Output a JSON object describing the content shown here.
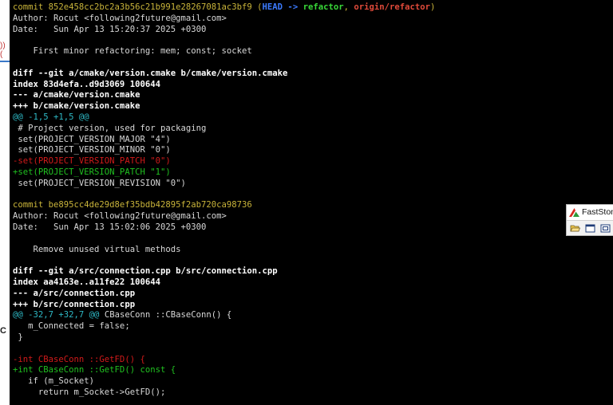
{
  "terminal": {
    "lines": [
      {
        "segments": [
          {
            "text": "commit 852e458cc2bc2a3b56c21b991e28267081ac3bf9 ",
            "style": "yellow"
          },
          {
            "text": "(",
            "style": "yellow"
          },
          {
            "text": "HEAD -> ",
            "style": "refblue"
          },
          {
            "text": "refactor",
            "style": "refgreen"
          },
          {
            "text": ", ",
            "style": "yellow"
          },
          {
            "text": "origin/refactor",
            "style": "refred"
          },
          {
            "text": ")",
            "style": "yellow"
          }
        ]
      },
      {
        "segments": [
          {
            "text": "Author: Rocut <following2future@gmail.com>",
            "style": "plain"
          }
        ]
      },
      {
        "segments": [
          {
            "text": "Date:   Sun Apr 13 15:20:37 2025 +0300",
            "style": "plain"
          }
        ]
      },
      {
        "segments": [
          {
            "text": "",
            "style": "plain"
          }
        ]
      },
      {
        "segments": [
          {
            "text": "    First minor refactoring: mem; const; socket",
            "style": "plain"
          }
        ]
      },
      {
        "segments": [
          {
            "text": "",
            "style": "plain"
          }
        ]
      },
      {
        "segments": [
          {
            "text": "diff --git a/cmake/version.cmake b/cmake/version.cmake",
            "style": "bold"
          }
        ]
      },
      {
        "segments": [
          {
            "text": "index 83d4efa..d9d3069 100644",
            "style": "bold"
          }
        ]
      },
      {
        "segments": [
          {
            "text": "--- a/cmake/version.cmake",
            "style": "bold"
          }
        ]
      },
      {
        "segments": [
          {
            "text": "+++ b/cmake/version.cmake",
            "style": "bold"
          }
        ]
      },
      {
        "segments": [
          {
            "text": "@@ -1,5 +1,5 @@",
            "style": "cyan"
          }
        ]
      },
      {
        "segments": [
          {
            "text": " # Project version, used for packaging",
            "style": "plain"
          }
        ]
      },
      {
        "segments": [
          {
            "text": " set(PROJECT_VERSION_MAJOR \"4\")",
            "style": "plain"
          }
        ]
      },
      {
        "segments": [
          {
            "text": " set(PROJECT_VERSION_MINOR \"0\")",
            "style": "plain"
          }
        ]
      },
      {
        "segments": [
          {
            "text": "-set(PROJECT_VERSION_PATCH \"0\")",
            "style": "red"
          }
        ]
      },
      {
        "segments": [
          {
            "text": "+set(PROJECT_VERSION_PATCH \"1\")",
            "style": "green"
          }
        ]
      },
      {
        "segments": [
          {
            "text": " set(PROJECT_VERSION_REVISION \"0\")",
            "style": "plain"
          }
        ]
      },
      {
        "segments": [
          {
            "text": "",
            "style": "plain"
          }
        ]
      },
      {
        "segments": [
          {
            "text": "commit be895cc4de29d8ef35bdb42895f2ab720ca98736",
            "style": "yellow"
          }
        ]
      },
      {
        "segments": [
          {
            "text": "Author: Rocut <following2future@gmail.com>",
            "style": "plain"
          }
        ]
      },
      {
        "segments": [
          {
            "text": "Date:   Sun Apr 13 15:02:06 2025 +0300",
            "style": "plain"
          }
        ]
      },
      {
        "segments": [
          {
            "text": "",
            "style": "plain"
          }
        ]
      },
      {
        "segments": [
          {
            "text": "    Remove unused virtual methods",
            "style": "plain"
          }
        ]
      },
      {
        "segments": [
          {
            "text": "",
            "style": "plain"
          }
        ]
      },
      {
        "segments": [
          {
            "text": "diff --git a/src/connection.cpp b/src/connection.cpp",
            "style": "bold"
          }
        ]
      },
      {
        "segments": [
          {
            "text": "index aa4163e..a11fe22 100644",
            "style": "bold"
          }
        ]
      },
      {
        "segments": [
          {
            "text": "--- a/src/connection.cpp",
            "style": "bold"
          }
        ]
      },
      {
        "segments": [
          {
            "text": "+++ b/src/connection.cpp",
            "style": "bold"
          }
        ]
      },
      {
        "segments": [
          {
            "text": "@@ -32,7 +32,7 @@",
            "style": "cyan"
          },
          {
            "text": " CBaseConn ::CBaseConn() {",
            "style": "plain"
          }
        ]
      },
      {
        "segments": [
          {
            "text": "   m_Connected = false;",
            "style": "plain"
          }
        ]
      },
      {
        "segments": [
          {
            "text": " }",
            "style": "plain"
          }
        ]
      },
      {
        "segments": [
          {
            "text": "",
            "style": "plain"
          }
        ]
      },
      {
        "segments": [
          {
            "text": "-int CBaseConn ::GetFD() {",
            "style": "red"
          }
        ]
      },
      {
        "segments": [
          {
            "text": "+int CBaseConn ::GetFD() const {",
            "style": "green"
          }
        ]
      },
      {
        "segments": [
          {
            "text": "   if (m_Socket)",
            "style": "plain"
          }
        ]
      },
      {
        "segments": [
          {
            "text": "     return m_Socket->GetFD();",
            "style": "plain"
          }
        ]
      }
    ]
  },
  "left_strip": {
    "fragment_top": ")) (",
    "fragment_bottom": "C"
  },
  "faststone": {
    "title": "FastStone",
    "buttons": [
      "folder-open-icon",
      "capture-window-icon",
      "capture-region-icon"
    ]
  },
  "colors": {
    "terminal_bg": "#000000",
    "commit_yellow": "#c9b43a",
    "removed_red": "#d11a1a",
    "added_green": "#20c020",
    "hunk_cyan": "#2eb8c4",
    "ref_head_blue": "#3c7bff"
  }
}
